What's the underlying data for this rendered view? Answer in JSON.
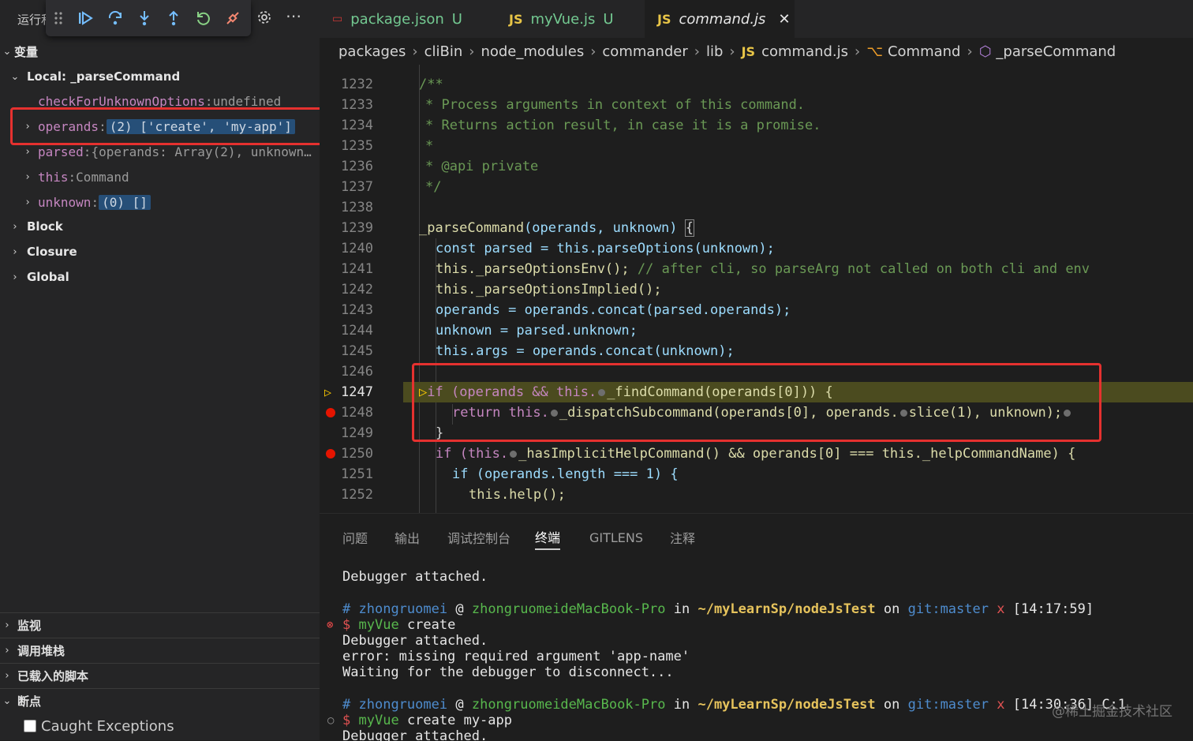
{
  "sidebar": {
    "title": "运行和",
    "variables_header": "变量",
    "local_header": "Local: _parseCommand",
    "vars": [
      {
        "name": "checkForUnknownOptions",
        "value": "undefined"
      },
      {
        "name": "operands",
        "value": "(2) ['create', 'my-app']"
      },
      {
        "name": "parsed",
        "value": "{operands: Array(2), unknown…"
      },
      {
        "name": "this",
        "value": "Command"
      },
      {
        "name": "unknown",
        "value": "(0) []"
      }
    ],
    "scopes": [
      "Block",
      "Closure",
      "Global"
    ],
    "bottom_sections": [
      "监视",
      "调用堆栈",
      "已载入的脚本",
      "断点"
    ],
    "caught_exceptions": "Caught Exceptions",
    "more": "⋯"
  },
  "tabs": [
    {
      "icon": "json-icon",
      "label": "package.json",
      "status": "U"
    },
    {
      "icon": "JS",
      "label": "myVue.js",
      "status": "U"
    },
    {
      "icon": "JS",
      "label": "command.js",
      "status": ""
    }
  ],
  "breadcrumb": {
    "items": [
      "packages",
      "cliBin",
      "node_modules",
      "commander",
      "lib"
    ],
    "file_icon": "JS",
    "file": "command.js",
    "class": "Command",
    "method": "_parseCommand"
  },
  "code": {
    "lines": [
      1232,
      1233,
      1234,
      1235,
      1236,
      1237,
      1238,
      1239,
      1240,
      1241,
      1242,
      1243,
      1244,
      1245,
      1246,
      1247,
      1248,
      1249,
      1250,
      1251,
      1252
    ],
    "text": {
      "l1232": "/**",
      "l1233": "* Process arguments in context of this command.",
      "l1234": "* Returns action result, in case it is a promise.",
      "l1235": "*",
      "l1236": "* @api private",
      "l1237": "*/",
      "l1239a": "_parseCommand",
      "l1239b": "(operands, unknown) ",
      "l1239c": "{",
      "l1240": "const parsed = this.parseOptions(unknown);",
      "l1241a": "this._parseOptionsEnv();",
      "l1241b": " // after cli, so parseArg not called on both cli and env",
      "l1242": "this._parseOptionsImplied();",
      "l1243": "operands = operands.concat(parsed.operands);",
      "l1244": "unknown = parsed.unknown;",
      "l1245": "this.args = operands.concat(unknown);",
      "l1247a": "if (operands && this.",
      "l1247b": "_findCommand(operands[0])) {",
      "l1248a": "return this.",
      "l1248b": "_dispatchSubcommand(operands[0], operands.",
      "l1248c": "slice(1), unknown);",
      "l1249": "}",
      "l1250a": "if (this.",
      "l1250b": "_hasImplicitHelpCommand() && operands[0] === this._helpCommandName) {",
      "l1251": "if (operands.length === 1) {",
      "l1252": "this.help();"
    }
  },
  "panel": {
    "tabs": [
      "问题",
      "输出",
      "调试控制台",
      "终端",
      "GITLENS",
      "注释"
    ],
    "active_tab": "终端",
    "terminal": {
      "l1": "Debugger attached.",
      "prompt_user": "zhongruomei",
      "prompt_at": "@",
      "prompt_host": "zhongruomeideMacBook-Pro",
      "prompt_in": "in",
      "prompt_path": "~/myLearnSp/nodeJsTest",
      "prompt_on": "on",
      "prompt_git": "git:master",
      "prompt_x": "x",
      "time1": "[14:17:59]",
      "cmd1_name": "myVue",
      "cmd1_args": "create",
      "out1": "Debugger attached.",
      "out2": "error: missing required argument 'app-name'",
      "out3": "Waiting for the debugger to disconnect...",
      "time2": "[14:30:36] C:1",
      "cmd2_name": "myVue",
      "cmd2_args": "create my-app",
      "out4": "Debugger attached."
    }
  },
  "watermark": "@稀土掘金技术社区",
  "colors": {
    "highlight_box": "#e5312f",
    "current_line": "#4b4b1f",
    "breakpoint": "#e51400"
  }
}
